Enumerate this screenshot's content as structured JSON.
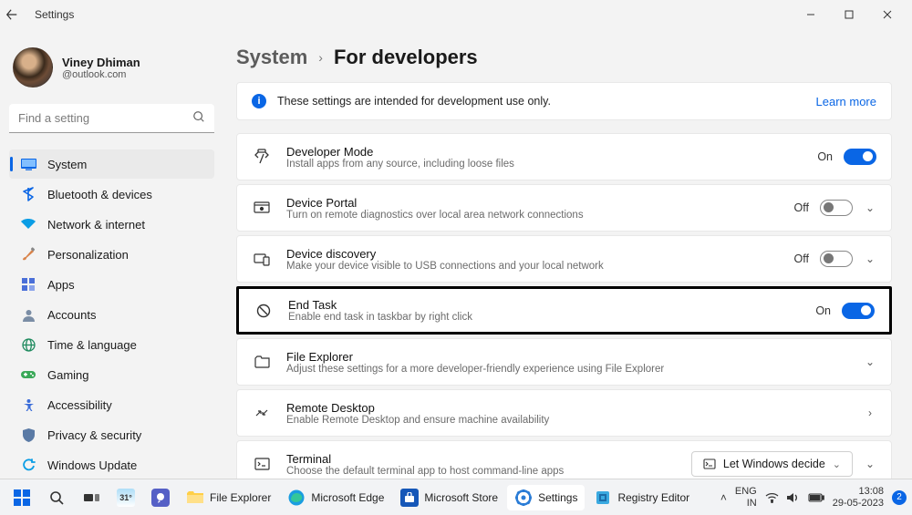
{
  "window": {
    "title": "Settings"
  },
  "profile": {
    "name": "Viney Dhiman",
    "email": "@outlook.com"
  },
  "search": {
    "placeholder": "Find a setting"
  },
  "sidebar": {
    "items": [
      {
        "label": "System"
      },
      {
        "label": "Bluetooth & devices"
      },
      {
        "label": "Network & internet"
      },
      {
        "label": "Personalization"
      },
      {
        "label": "Apps"
      },
      {
        "label": "Accounts"
      },
      {
        "label": "Time & language"
      },
      {
        "label": "Gaming"
      },
      {
        "label": "Accessibility"
      },
      {
        "label": "Privacy & security"
      },
      {
        "label": "Windows Update"
      }
    ]
  },
  "breadcrumb": {
    "parent": "System",
    "current": "For developers"
  },
  "info": {
    "message": "These settings are intended for development use only.",
    "learn_more": "Learn more"
  },
  "rows": [
    {
      "title": "Developer Mode",
      "desc": "Install apps from any source, including loose files",
      "state": "On",
      "toggle": "on"
    },
    {
      "title": "Device Portal",
      "desc": "Turn on remote diagnostics over local area network connections",
      "state": "Off",
      "toggle": "off"
    },
    {
      "title": "Device discovery",
      "desc": "Make your device visible to USB connections and your local network",
      "state": "Off",
      "toggle": "off"
    },
    {
      "title": "End Task",
      "desc": "Enable end task in taskbar by right click",
      "state": "On",
      "toggle": "on"
    },
    {
      "title": "File Explorer",
      "desc": "Adjust these settings for a more developer-friendly experience using File Explorer"
    },
    {
      "title": "Remote Desktop",
      "desc": "Enable Remote Desktop and ensure machine availability"
    },
    {
      "title": "Terminal",
      "desc": "Choose the default terminal app to host command-line apps",
      "dropdown": "Let Windows decide"
    }
  ],
  "taskbar": {
    "items": [
      {
        "label": "File Explorer"
      },
      {
        "label": "Microsoft Edge"
      },
      {
        "label": "Microsoft Store"
      },
      {
        "label": "Settings"
      },
      {
        "label": "Registry Editor"
      }
    ],
    "lang_top": "ENG",
    "lang_bot": "IN",
    "time": "13:08",
    "date": "29-05-2023",
    "weather": "31°",
    "notifications": "2"
  }
}
